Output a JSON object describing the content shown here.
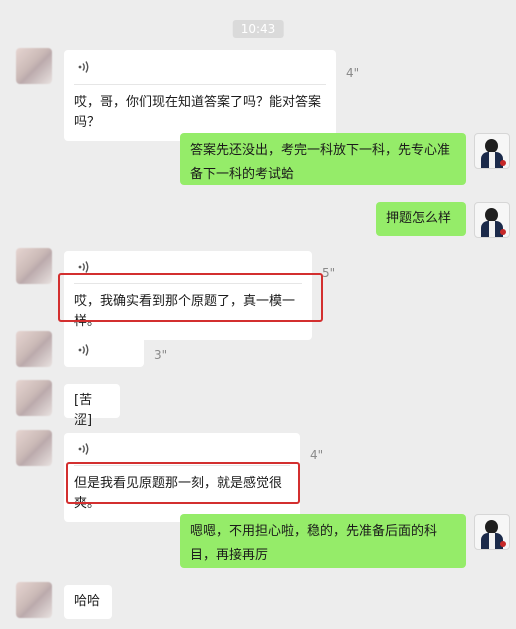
{
  "timestamp": "10:43",
  "messages": {
    "m1": {
      "duration": "4\"",
      "transcript": "哎，哥，你们现在知道答案了吗？能对答案吗？"
    },
    "m2": {
      "text": "答案先还没出，考完一科放下一科，先专心准备下一科的考试蛤"
    },
    "m3": {
      "text": "押题怎么样"
    },
    "m4": {
      "duration": "5\"",
      "transcript": "哎，我确实看到那个原题了，真一模一样。"
    },
    "m5": {
      "duration": "3\""
    },
    "m6": {
      "text": "[苦涩]"
    },
    "m7": {
      "duration": "4\"",
      "transcript": "但是我看见原题那一刻，就是感觉很爽。"
    },
    "m8": {
      "text": "嗯嗯，不用担心啦，稳的，先准备后面的科目，再接再厉"
    },
    "m9": {
      "text": "哈哈"
    }
  },
  "colors": {
    "sent_bubble": "#95ec69",
    "highlight_border": "#d32f2f",
    "background": "#ededed"
  },
  "icons": {
    "voice": "voice-wave-icon"
  }
}
